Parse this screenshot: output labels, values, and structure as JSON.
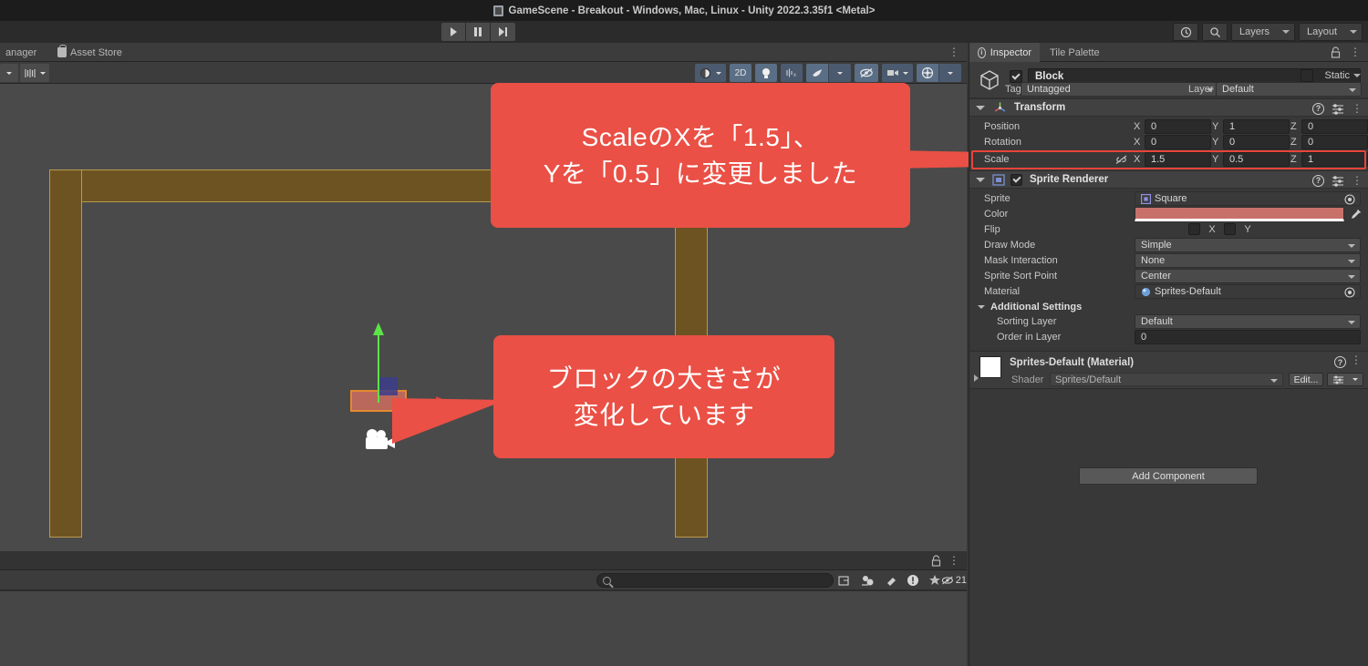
{
  "window": {
    "title": "GameScene - Breakout - Windows, Mac, Linux - Unity 2022.3.35f1 <Metal>",
    "title_icon": "unity-scene-icon"
  },
  "toolbar": {
    "play_icon": "play-icon",
    "pause_icon": "pause-icon",
    "step_icon": "step-icon",
    "history_icon": "history-icon",
    "search_icon": "search-icon",
    "layers_label": "Layers",
    "layout_label": "Layout"
  },
  "scene_tabs": {
    "tab1_label": "anager",
    "tab2_label": "Asset Store",
    "tab2_icon": "asset-store-bag-icon"
  },
  "scene_toolbar": {
    "left_buttons": [
      {
        "name": "tool-handle-dropdown",
        "icon": "chevron-down-icon"
      },
      {
        "name": "grid-snapping-dropdown",
        "icon": "grid-snap-icon"
      }
    ],
    "right_buttons": [
      {
        "name": "draw-mode-dropdown",
        "label": "",
        "icon": "shaded-sphere-icon"
      },
      {
        "name": "2d-toggle",
        "label": "2D"
      },
      {
        "name": "lighting-toggle",
        "icon": "light-bulb-icon"
      },
      {
        "name": "audio-toggle",
        "icon": "audio-icon"
      },
      {
        "name": "effects-toggle",
        "icon": "fx-icon"
      },
      {
        "name": "scene-visibility-toggle",
        "icon": "eye-off-icon"
      },
      {
        "name": "camera-settings",
        "icon": "camera-icon"
      },
      {
        "name": "gizmos-toggle",
        "icon": "gizmos-icon"
      }
    ]
  },
  "scene": {
    "objects": [
      {
        "name": "wall-top",
        "color": "#6e5322"
      },
      {
        "name": "wall-left",
        "color": "#6e5322"
      },
      {
        "name": "wall-right",
        "color": "#6e5322"
      },
      {
        "name": "block",
        "color": "#c46b5e"
      },
      {
        "name": "ball",
        "color": "#ffffff"
      },
      {
        "name": "paddle",
        "color": "#ffffff"
      },
      {
        "name": "camera-gizmo",
        "color": "#ffffff"
      }
    ],
    "gizmo": {
      "x_axis_color": "#d14848",
      "y_axis_color": "#5ee24a",
      "z_axis_color": "#3c3c8c"
    }
  },
  "callouts": [
    {
      "name": "callout-scale-changed",
      "line1": "ScaleのXを「1.5」、",
      "line2": "Yを「0.5」に変更しました",
      "color": "#ea5045"
    },
    {
      "name": "callout-block-size",
      "line1": "ブロックの大きさが",
      "line2": "変化しています",
      "color": "#ea5045"
    }
  ],
  "inspector": {
    "tabs": [
      {
        "label": "Inspector",
        "active": true,
        "icon": "info-icon"
      },
      {
        "label": "Tile Palette",
        "active": false
      }
    ],
    "lock_icon": "lock-icon",
    "kebab_icon": "kebab-menu-icon",
    "object_header": {
      "icon": "game-object-cube-icon",
      "active_checked": true,
      "name": "Block",
      "static_label": "Static",
      "tag_label": "Tag",
      "tag_value": "Untagged",
      "layer_label": "Layer",
      "layer_value": "Default"
    },
    "transform": {
      "title": "Transform",
      "icon": "transform-axis-icon",
      "rows": [
        {
          "label": "Position",
          "x": "0",
          "y": "1",
          "z": "0",
          "highlighted": false
        },
        {
          "label": "Rotation",
          "x": "0",
          "y": "0",
          "z": "0",
          "highlighted": false
        },
        {
          "label": "Scale",
          "x": "1.5",
          "y": "0.5",
          "z": "1",
          "highlighted": true,
          "constrain_icon": "constrain-proportions-off-icon"
        }
      ],
      "axis_labels": {
        "x": "X",
        "y": "Y",
        "z": "Z"
      },
      "highlight_color": "#e8443a"
    },
    "sprite_renderer": {
      "title": "Sprite Renderer",
      "icon": "sprite-renderer-icon",
      "enabled": true,
      "fields": [
        {
          "label": "Sprite",
          "value": "Square",
          "type": "object",
          "icon": "sprite-asset-icon"
        },
        {
          "label": "Color",
          "value": "",
          "type": "color",
          "swatch": "#c8716a",
          "picker_icon": "eyedropper-icon"
        },
        {
          "label": "Flip",
          "type": "flip",
          "x_label": "X",
          "y_label": "Y"
        },
        {
          "label": "Draw Mode",
          "value": "Simple",
          "type": "dropdown"
        },
        {
          "label": "Mask Interaction",
          "value": "None",
          "type": "dropdown"
        },
        {
          "label": "Sprite Sort Point",
          "value": "Center",
          "type": "dropdown"
        },
        {
          "label": "Material",
          "value": "Sprites-Default",
          "type": "object",
          "icon": "material-sphere-icon"
        }
      ],
      "additional_settings": {
        "title": "Additional Settings",
        "fields": [
          {
            "label": "Sorting Layer",
            "value": "Default",
            "type": "dropdown"
          },
          {
            "label": "Order in Layer",
            "value": "0",
            "type": "number"
          }
        ]
      }
    },
    "material_panel": {
      "title": "Sprites-Default (Material)",
      "shader_label": "Shader",
      "shader_value": "Sprites/Default",
      "edit_button": "Edit...",
      "swatch_color": "#ffffff"
    },
    "add_component_label": "Add Component"
  },
  "console": {
    "lock_icon": "lock-icon",
    "kebab_icon": "kebab-menu-icon",
    "search_placeholder": "",
    "search_value": "",
    "buttons": [
      {
        "name": "console-clear-on-build-icon",
        "icon": "window-icon"
      },
      {
        "name": "console-collapse-icon",
        "icon": "collapse-icon"
      },
      {
        "name": "console-clear-icon",
        "icon": "eraser-icon"
      },
      {
        "name": "console-error-filter",
        "icon": "error-icon"
      },
      {
        "name": "console-favorite-filter",
        "icon": "star-icon"
      }
    ],
    "hidden_count": "21",
    "hidden_icon": "eye-off-icon"
  }
}
